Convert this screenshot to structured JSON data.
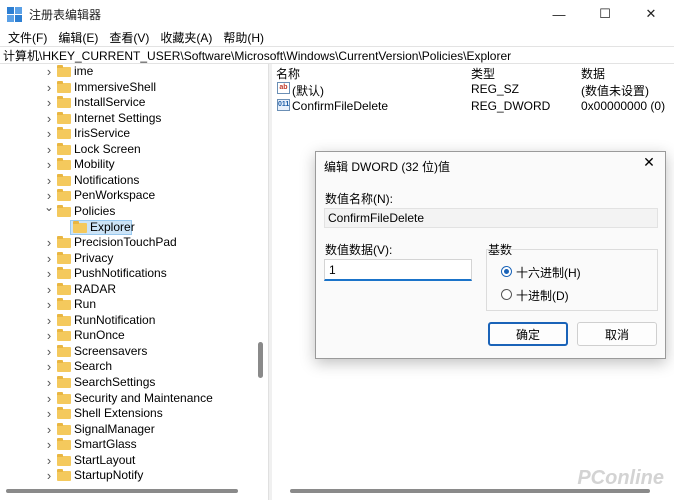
{
  "window": {
    "title": "注册表编辑器",
    "minimize": "—",
    "maximize": "☐",
    "close": "✕"
  },
  "menu": [
    "文件(F)",
    "编辑(E)",
    "查看(V)",
    "收藏夹(A)",
    "帮助(H)"
  ],
  "address": "计算机\\HKEY_CURRENT_USER\\Software\\Microsoft\\Windows\\CurrentVersion\\Policies\\Explorer",
  "tree": [
    {
      "label": "ime",
      "expanded": false,
      "level": 0
    },
    {
      "label": "ImmersiveShell",
      "expanded": false,
      "level": 0
    },
    {
      "label": "InstallService",
      "expanded": false,
      "level": 0
    },
    {
      "label": "Internet Settings",
      "expanded": false,
      "level": 0
    },
    {
      "label": "IrisService",
      "expanded": false,
      "level": 0
    },
    {
      "label": "Lock Screen",
      "expanded": false,
      "level": 0
    },
    {
      "label": "Mobility",
      "expanded": false,
      "level": 0
    },
    {
      "label": "Notifications",
      "expanded": false,
      "level": 0
    },
    {
      "label": "PenWorkspace",
      "expanded": false,
      "level": 0
    },
    {
      "label": "Policies",
      "expanded": true,
      "level": 0
    },
    {
      "label": "Explorer",
      "expanded": null,
      "level": 1,
      "selected": true
    },
    {
      "label": "PrecisionTouchPad",
      "expanded": false,
      "level": 0
    },
    {
      "label": "Privacy",
      "expanded": false,
      "level": 0
    },
    {
      "label": "PushNotifications",
      "expanded": false,
      "level": 0
    },
    {
      "label": "RADAR",
      "expanded": false,
      "level": 0
    },
    {
      "label": "Run",
      "expanded": false,
      "level": 0
    },
    {
      "label": "RunNotification",
      "expanded": false,
      "level": 0
    },
    {
      "label": "RunOnce",
      "expanded": false,
      "level": 0
    },
    {
      "label": "Screensavers",
      "expanded": false,
      "level": 0
    },
    {
      "label": "Search",
      "expanded": false,
      "level": 0
    },
    {
      "label": "SearchSettings",
      "expanded": false,
      "level": 0
    },
    {
      "label": "Security and Maintenance",
      "expanded": false,
      "level": 0
    },
    {
      "label": "Shell Extensions",
      "expanded": false,
      "level": 0
    },
    {
      "label": "SignalManager",
      "expanded": false,
      "level": 0
    },
    {
      "label": "SmartGlass",
      "expanded": false,
      "level": 0
    },
    {
      "label": "StartLayout",
      "expanded": false,
      "level": 0
    },
    {
      "label": "StartupNotify",
      "expanded": false,
      "level": 0
    }
  ],
  "list": {
    "headers": {
      "name": "名称",
      "type": "类型",
      "data": "数据"
    },
    "rows": [
      {
        "icon": "string-value-icon",
        "icon_text": "ab",
        "name": "(默认)",
        "type": "REG_SZ",
        "data": "(数值未设置)"
      },
      {
        "icon": "binary-value-icon",
        "icon_text": "011",
        "name": "ConfirmFileDelete",
        "type": "REG_DWORD",
        "data": "0x00000000 (0)"
      }
    ]
  },
  "dialog": {
    "title": "编辑 DWORD (32 位)值",
    "close": "✕",
    "name_label": "数值名称(N):",
    "name_value": "ConfirmFileDelete",
    "data_label": "数值数据(V):",
    "data_value": "1",
    "base_label": "基数",
    "hex_label": "十六进制(H)",
    "dec_label": "十进制(D)",
    "hex_checked": true,
    "ok": "确定",
    "cancel": "取消"
  },
  "watermark": "PConline",
  "colors": {
    "accent": "#1a63b8",
    "selection": "#cce4f7",
    "folder": "#f4c95d"
  }
}
